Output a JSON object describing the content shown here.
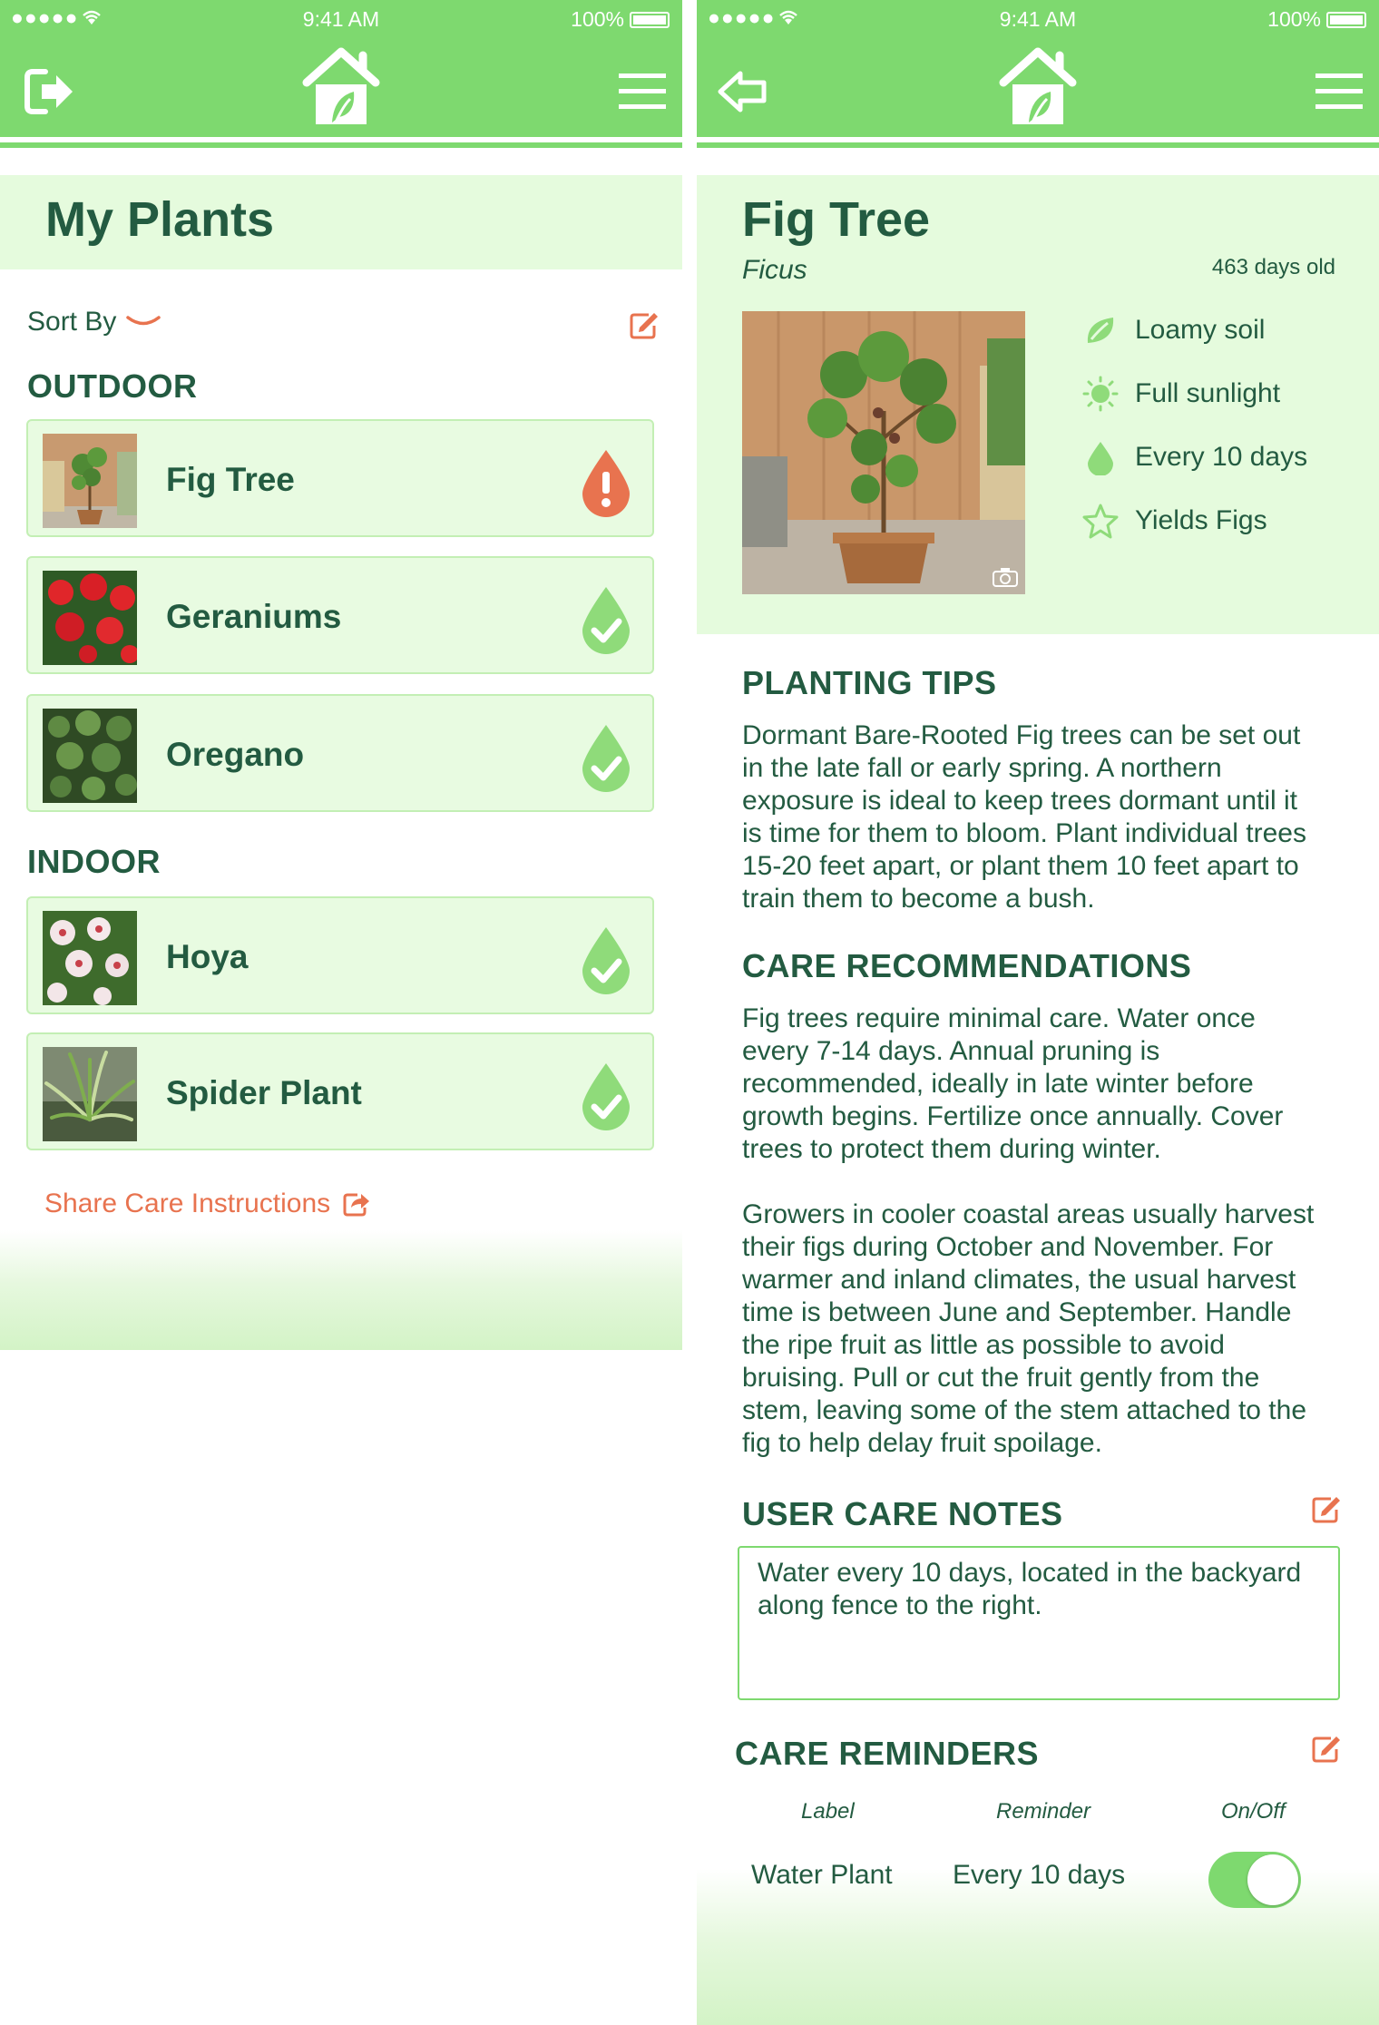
{
  "status_bar": {
    "time": "9:41 AM",
    "battery": "100%"
  },
  "colors": {
    "primary_green": "#7ed96f",
    "light_green": "#e5fbdd",
    "dark_green": "#235b41",
    "alert_orange": "#e8734f",
    "ok_green": "#8fdb7a"
  },
  "list_screen": {
    "title": "My Plants",
    "sort_label": "Sort By",
    "outdoor_header": "OUTDOOR",
    "indoor_header": "INDOOR",
    "outdoor": [
      {
        "name": "Fig Tree",
        "status": "alert"
      },
      {
        "name": "Geraniums",
        "status": "ok"
      },
      {
        "name": "Oregano",
        "status": "ok"
      }
    ],
    "indoor": [
      {
        "name": "Hoya",
        "status": "ok"
      },
      {
        "name": "Spider Plant",
        "status": "ok"
      }
    ],
    "share_label": "Share Care Instructions"
  },
  "detail_screen": {
    "name": "Fig Tree",
    "latin": "Ficus",
    "age": "463 days old",
    "attributes": {
      "soil": "Loamy soil",
      "sun": "Full sunlight",
      "water": "Every 10 days",
      "yield": "Yields Figs"
    },
    "planting_tips_title": "PLANTING TIPS",
    "planting_tips": [
      "Dormant Bare-Rooted Fig trees can be set out",
      "in the late fall or early spring.  A northern",
      "exposure is ideal to keep trees dormant until it",
      "is time for them to bloom.  Plant individual trees",
      "15-20 feet apart, or plant them 10 feet apart to",
      "train them to become a bush."
    ],
    "care_title": "CARE RECOMMENDATIONS",
    "care_1": [
      "Fig trees require minimal care.  Water once",
      "every 7-14 days.  Annual pruning is",
      "recommended, ideally in late winter before",
      "growth begins.  Fertilize once annually.  Cover",
      "trees to protect them during winter."
    ],
    "care_2": [
      "Growers in cooler coastal areas usually harvest",
      "their figs during October and November. For",
      "warmer and inland climates, the usual harvest",
      "time is between June and September.   Handle",
      "the ripe fruit as little as possible to avoid",
      "bruising. Pull or cut the fruit gently from the",
      "stem, leaving some of the stem attached to the",
      "fig to help delay fruit spoilage."
    ],
    "notes_title": "USER CARE NOTES",
    "notes_text": "Water every 10 days, located in the backyard along fence to the right.",
    "reminders_title": "CARE REMINDERS",
    "reminder_columns": {
      "label": "Label",
      "reminder": "Reminder",
      "toggle": "On/Off"
    },
    "reminders": [
      {
        "label": "Water Plant",
        "reminder": "Every 10 days",
        "on": true
      }
    ]
  }
}
